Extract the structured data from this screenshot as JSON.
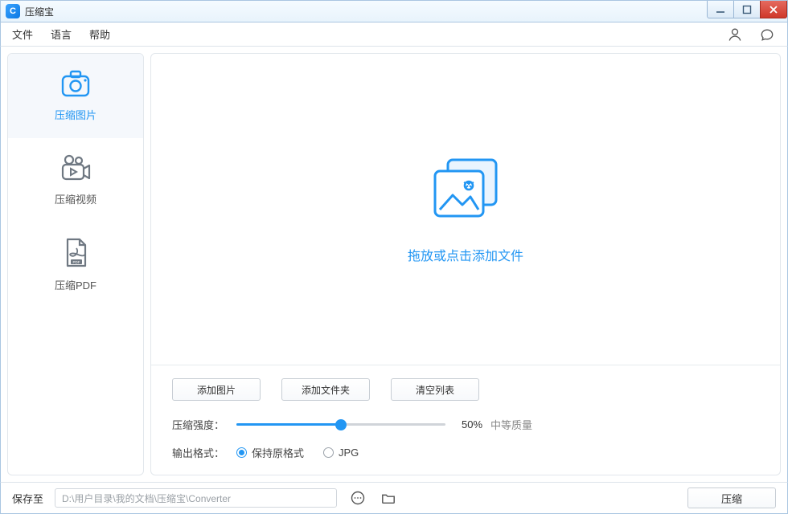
{
  "window": {
    "title": "压缩宝"
  },
  "menubar": {
    "file": "文件",
    "language": "语言",
    "help": "帮助"
  },
  "sidebar": {
    "items": [
      {
        "label": "压缩图片"
      },
      {
        "label": "压缩视频"
      },
      {
        "label": "压缩PDF"
      }
    ],
    "active": 0
  },
  "dropzone": {
    "text": "拖放或点击添加文件"
  },
  "controls": {
    "add_image": "添加图片",
    "add_folder": "添加文件夹",
    "clear_list": "清空列表",
    "strength_label": "压缩强度：",
    "strength_percent": "50%",
    "strength_value": 50,
    "strength_hint": "中等质量",
    "format_label": "输出格式：",
    "format_keep": "保持原格式",
    "format_jpg": "JPG",
    "format_selected": "keep"
  },
  "footer": {
    "save_to_label": "保存至",
    "path": "D:\\用户目录\\我的文档\\压缩宝\\Converter",
    "compress_label": "压缩"
  }
}
